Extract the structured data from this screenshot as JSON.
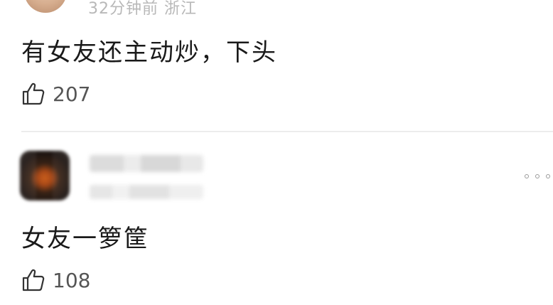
{
  "comments": [
    {
      "meta": "32分钟前 浙江",
      "text": "有女友还主动炒，下头",
      "likes": "207"
    },
    {
      "text": "女友一箩筐",
      "likes": "108"
    }
  ],
  "icons": {
    "like": "thumbs-up-icon",
    "more": "more-icon"
  },
  "colors": {
    "text": "#1a1a1a",
    "meta": "#b8b8b8",
    "like_count": "#555555",
    "divider": "#ececec"
  }
}
